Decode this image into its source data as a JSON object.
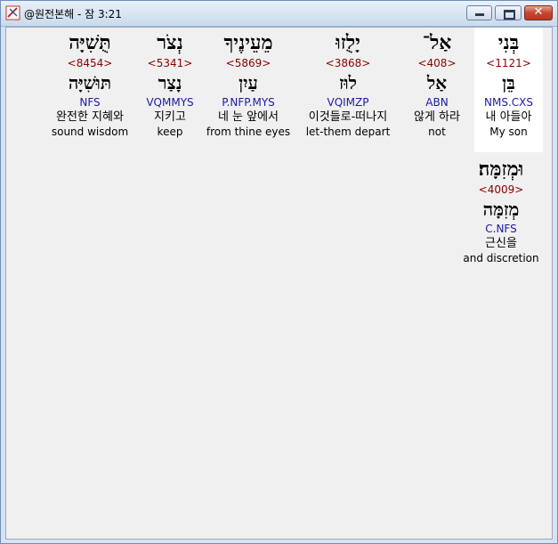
{
  "window": {
    "title": "@원전본해 - 잠 3:21",
    "close_glyph": "✕"
  },
  "words": [
    {
      "hebrew": "בְּנִי",
      "strongs": "<1121>",
      "lemma": "בֵּן",
      "parse": "NMS.CXS",
      "korean": "내 아들아",
      "english": "My son"
    },
    {
      "hebrew": "אַל־",
      "strongs": "<408>",
      "lemma": "אַל",
      "parse": "ABN",
      "korean": "않게 하라",
      "english": "not"
    },
    {
      "hebrew": "יָלֻזוּ",
      "strongs": "<3868>",
      "lemma": "לוּז",
      "parse": "VQIMZP",
      "korean": "이것들로-떠나지",
      "english": "let-them depart"
    },
    {
      "hebrew": "מֵעֵינֶיךָ",
      "strongs": "<5869>",
      "lemma": "עַיִן",
      "parse": "P.NFP.MYS",
      "korean": "네 눈 앞에서",
      "english": "from thine eyes"
    },
    {
      "hebrew": "נְצֹר",
      "strongs": "<5341>",
      "lemma": "נָצַר",
      "parse": "VQMMYS",
      "korean": "지키고",
      "english": "keep"
    },
    {
      "hebrew": "תֻּשִׁיָּה",
      "strongs": "<8454>",
      "lemma": "תּוּשִׁיָּה",
      "parse": "NFS",
      "korean": "완전한 지혜와",
      "english": "sound wisdom"
    },
    {
      "hebrew": "וּמְזִמָּה׃",
      "strongs": "<4009>",
      "lemma": "מְזִמָּה",
      "parse": "C.NFS",
      "korean": "근신을",
      "english": "and discretion"
    }
  ]
}
